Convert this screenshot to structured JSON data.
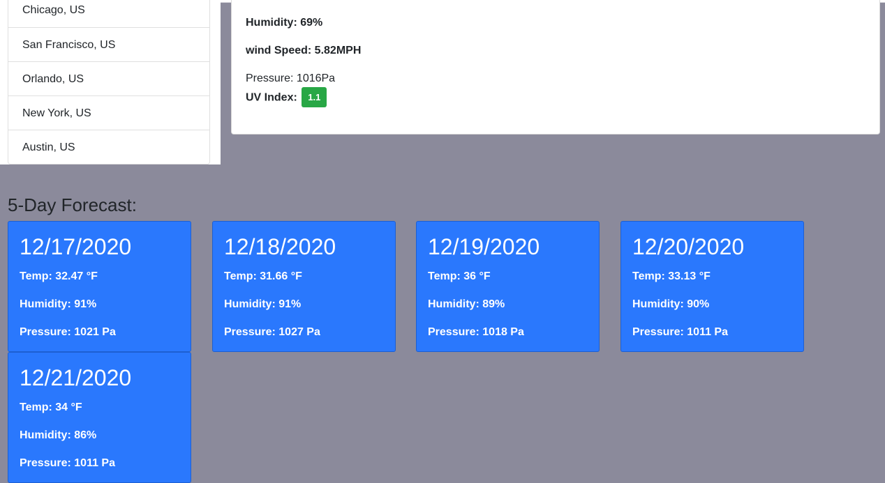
{
  "cities": [
    {
      "label": "Chicago, US"
    },
    {
      "label": "San Francisco, US"
    },
    {
      "label": "Orlando, US"
    },
    {
      "label": "New York, US"
    },
    {
      "label": "Austin, US"
    }
  ],
  "current": {
    "humidity": "Humidity: 69%",
    "wind": "wind Speed: 5.82MPH",
    "pressure": "Pressure: 1016Pa",
    "uv_label": "UV Index:",
    "uv_value": "1.1",
    "uv_color": "#28a745"
  },
  "forecast": {
    "title": "5-Day Forecast:",
    "days": [
      {
        "date": "12/17/2020",
        "temp": "Temp: 32.47 °F",
        "humidity": "Humidity: 91%",
        "pressure": "Pressure: 1021 Pa"
      },
      {
        "date": "12/18/2020",
        "temp": "Temp: 31.66 °F",
        "humidity": "Humidity: 91%",
        "pressure": "Pressure: 1027 Pa"
      },
      {
        "date": "12/19/2020",
        "temp": "Temp: 36 °F",
        "humidity": "Humidity: 89%",
        "pressure": "Pressure: 1018 Pa"
      },
      {
        "date": "12/20/2020",
        "temp": "Temp: 33.13 °F",
        "humidity": "Humidity: 90%",
        "pressure": "Pressure: 1011 Pa"
      },
      {
        "date": "12/21/2020",
        "temp": "Temp: 34 °F",
        "humidity": "Humidity: 86%",
        "pressure": "Pressure: 1011 Pa"
      }
    ],
    "card_color": "#2a78fd"
  },
  "page_background": "#8b8a9b"
}
